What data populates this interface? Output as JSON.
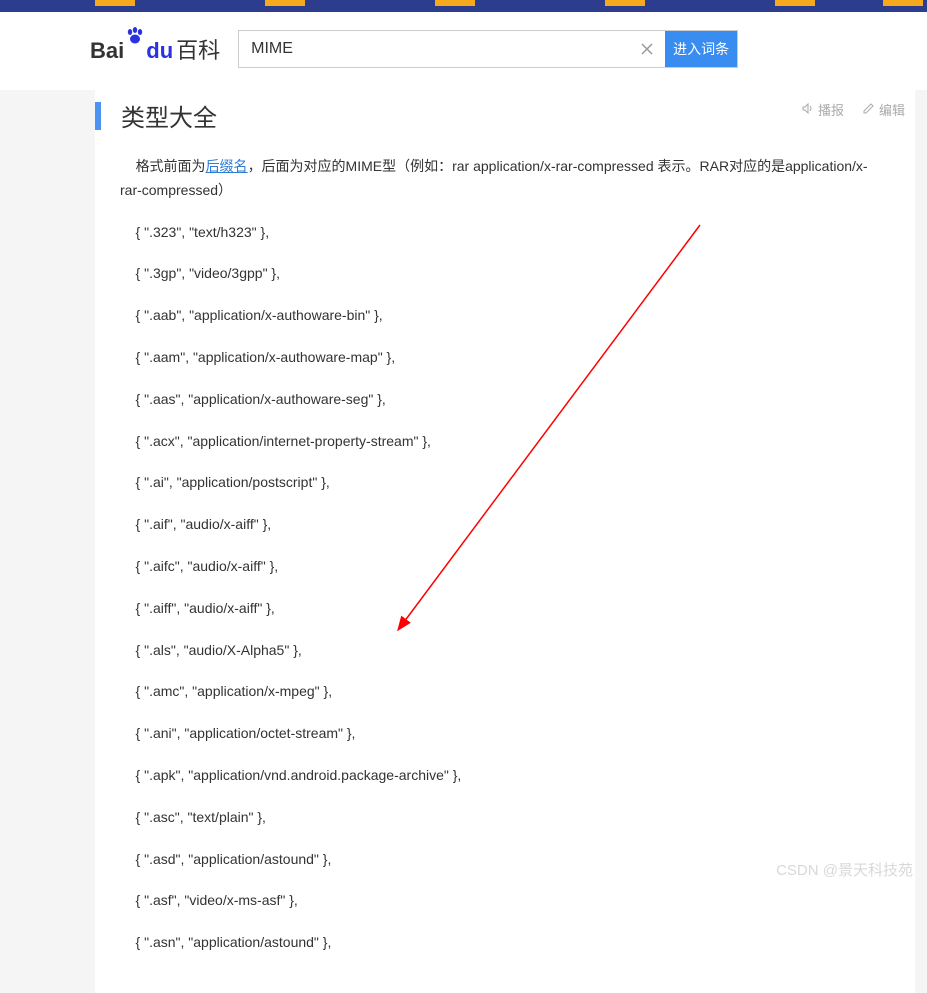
{
  "logo": {
    "bai": "Bai",
    "du": "du",
    "baike": "百科"
  },
  "search": {
    "value": "MIME",
    "button": "进入词条"
  },
  "section": {
    "title": "类型大全",
    "broadcast": "播报",
    "edit": "编辑"
  },
  "intro": {
    "prefix": "格式前面为",
    "link": "后缀名",
    "suffix": "，后面为对应的MIME型（例如：rar application/x-rar-compressed 表示。RAR对应的是application/x-rar-compressed）"
  },
  "mime_items": [
    "{ \".323\", \"text/h323\" },",
    "{ \".3gp\", \"video/3gpp\" },",
    "{ \".aab\", \"application/x-authoware-bin\" },",
    "{ \".aam\", \"application/x-authoware-map\" },",
    "{ \".aas\", \"application/x-authoware-seg\" },",
    "{ \".acx\", \"application/internet-property-stream\" },",
    "{ \".ai\", \"application/postscript\" },",
    "{ \".aif\", \"audio/x-aiff\" },",
    "{ \".aifc\", \"audio/x-aiff\" },",
    "{ \".aiff\", \"audio/x-aiff\" },",
    "{ \".als\", \"audio/X-Alpha5\" },",
    "{ \".amc\", \"application/x-mpeg\" },",
    "{ \".ani\", \"application/octet-stream\" },",
    "{ \".apk\", \"application/vnd.android.package-archive\" },",
    "{ \".asc\", \"text/plain\" },",
    "{ \".asd\", \"application/astound\" },",
    "{ \".asf\", \"video/x-ms-asf\" },",
    "{ \".asn\", \"application/astound\" },"
  ],
  "watermark": "CSDN @景天科技苑"
}
